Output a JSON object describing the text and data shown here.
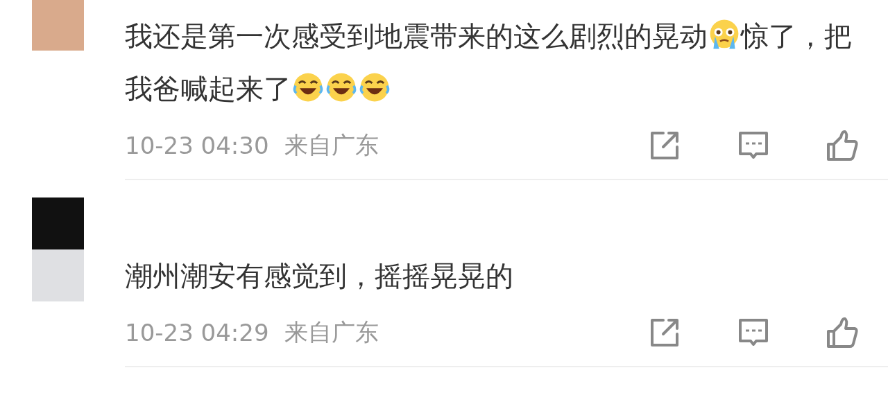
{
  "comments": [
    {
      "body": [
        {
          "kind": "text",
          "text": "我还是第一次感受到地震带来的这么剧烈的晃动"
        },
        {
          "kind": "crying-emoji"
        },
        {
          "kind": "text",
          "text": "惊了，把我爸喊起来了"
        },
        {
          "kind": "laughing-emoji"
        },
        {
          "kind": "laughing-emoji"
        },
        {
          "kind": "laughing-emoji"
        }
      ],
      "time": "10-23 04:30",
      "location": "来自广东"
    },
    {
      "body": [
        {
          "kind": "text",
          "text": "潮州潮安有感觉到，摇摇晃晃的"
        }
      ],
      "time": "10-23 04:29",
      "location": "来自广东"
    }
  ]
}
